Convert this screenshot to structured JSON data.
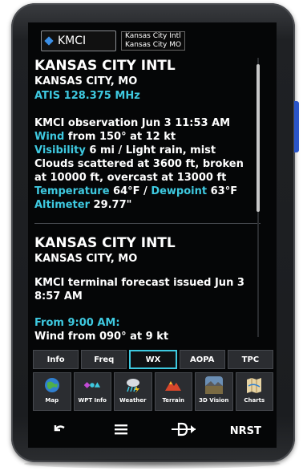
{
  "header": {
    "identifier": "KMCI",
    "name_line1": "Kansas City Intl",
    "name_line2": "Kansas City MO"
  },
  "observation": {
    "airport": "KANSAS CITY INTL",
    "city": "KANSAS CITY, MO",
    "atis": "ATIS 128.375 MHz",
    "issued": "KMCI observation Jun 3 11:53 AM",
    "wind_label": "Wind",
    "wind_value": " from 150° at 12 kt",
    "visibility_label": "Visibility",
    "visibility_value": " 6 mi / Light rain, mist",
    "clouds": "Clouds scattered at 3600 ft, broken at 10000 ft, overcast at 13000 ft",
    "temperature_label": "Temperature",
    "temperature_value": " 64°F / ",
    "dewpoint_label": "Dewpoint",
    "dewpoint_value": " 63°F",
    "altimeter_label": "Altimeter",
    "altimeter_value": " 29.77\""
  },
  "forecast": {
    "airport": "KANSAS CITY INTL",
    "city": "KANSAS CITY, MO",
    "issued": "KMCI terminal forecast issued Jun 3 8:57 AM",
    "from_label": "From 9:00 AM:",
    "wind_text": "Wind from 090° at 9 kt"
  },
  "tabs": [
    {
      "label": "Info",
      "selected": false
    },
    {
      "label": "Freq",
      "selected": false
    },
    {
      "label": "WX",
      "selected": true
    },
    {
      "label": "AOPA",
      "selected": false
    },
    {
      "label": "TPC",
      "selected": false
    }
  ],
  "apps": [
    {
      "label": "Map",
      "icon": "globe-icon"
    },
    {
      "label": "WPT Info",
      "icon": "waypoint-info-icon"
    },
    {
      "label": "Weather",
      "icon": "weather-icon"
    },
    {
      "label": "Terrain",
      "icon": "terrain-icon"
    },
    {
      "label": "3D Vision",
      "icon": "3d-vision-icon"
    },
    {
      "label": "Charts",
      "icon": "charts-icon"
    }
  ],
  "nav": {
    "back_icon": "back-arrow-icon",
    "menu_icon": "menu-icon",
    "direct_to_icon": "direct-to-icon",
    "nrst_label": "NRST"
  },
  "colors": {
    "accent": "#3ec9e0",
    "waypoint_blue": "#3b8fe6",
    "screen_bg": "#050607"
  }
}
